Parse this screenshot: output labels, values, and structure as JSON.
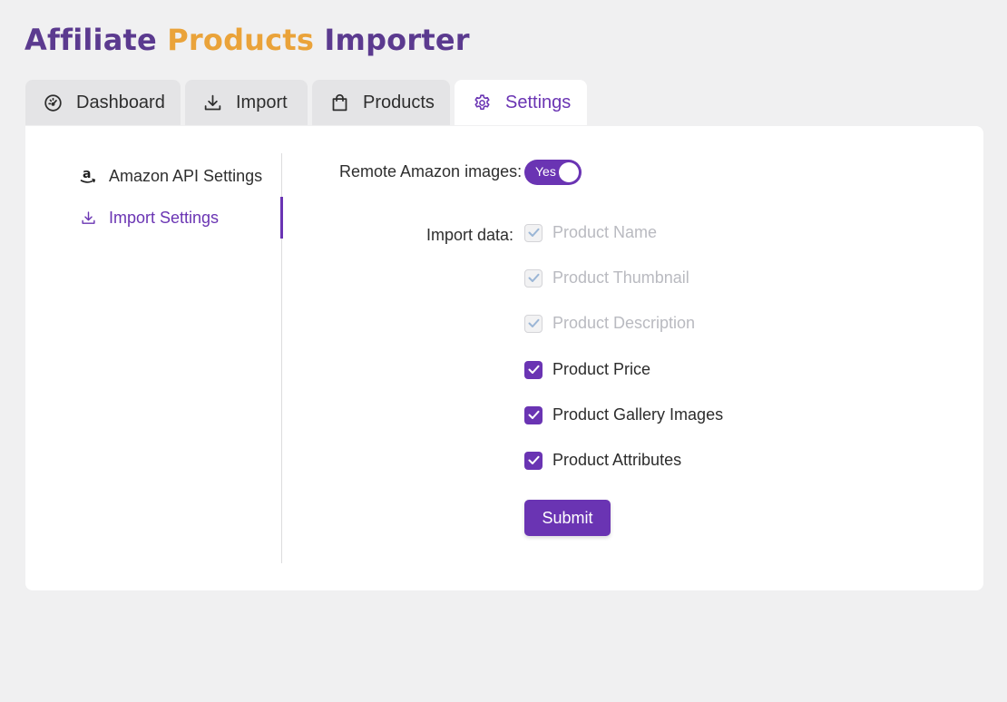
{
  "app": {
    "title_part1": "Affiliate ",
    "title_part2": "Products",
    "title_part3": " Importer"
  },
  "tabs": [
    {
      "label": "Dashboard",
      "icon": "speedometer-icon"
    },
    {
      "label": "Import",
      "icon": "download-icon"
    },
    {
      "label": "Products",
      "icon": "shopping-bag-icon"
    },
    {
      "label": "Settings",
      "icon": "gear-icon",
      "active": true
    }
  ],
  "sidebar": {
    "items": [
      {
        "label": "Amazon API Settings",
        "icon": "amazon-icon"
      },
      {
        "label": "Import Settings",
        "icon": "download-icon",
        "active": true
      }
    ]
  },
  "settings": {
    "remote_images_label": "Remote Amazon images",
    "remote_images_colon": ":",
    "remote_images_value": "Yes",
    "import_data_label": "Import data",
    "import_data_colon": ":",
    "options": [
      {
        "label": "Product Name",
        "checked": true,
        "disabled": true
      },
      {
        "label": "Product Thumbnail",
        "checked": true,
        "disabled": true
      },
      {
        "label": "Product Description",
        "checked": true,
        "disabled": true
      },
      {
        "label": "Product Price",
        "checked": true,
        "disabled": false
      },
      {
        "label": "Product Gallery Images",
        "checked": true,
        "disabled": false
      },
      {
        "label": "Product Attributes",
        "checked": true,
        "disabled": false
      }
    ],
    "submit_label": "Submit"
  },
  "colors": {
    "accent": "#6a34b3",
    "title_purple": "#5b3a8f",
    "title_orange": "#eaa33a",
    "background": "#f0f0f1",
    "panel": "#ffffff"
  }
}
